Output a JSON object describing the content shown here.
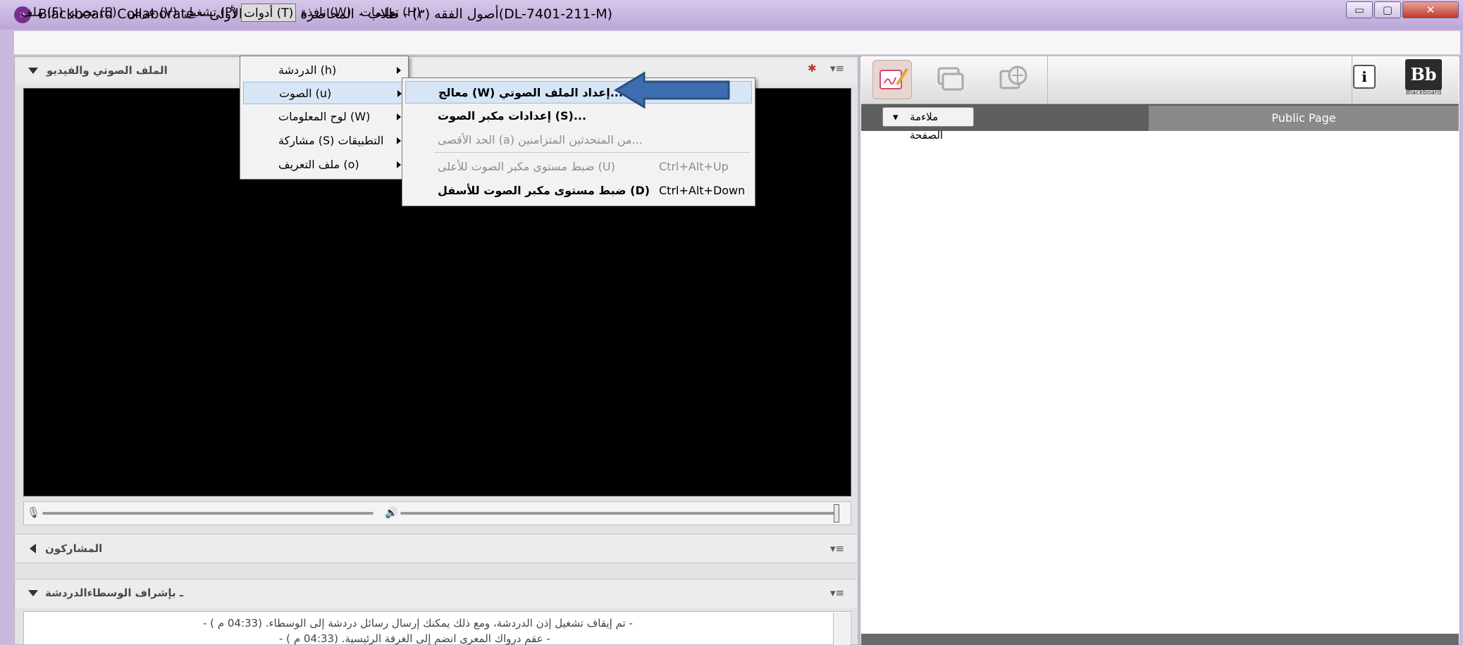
{
  "window": {
    "title": "Blackboard Collaborate – أصول الفقه (٣) - طلاب - المحاضرة المباشرة الأولى(DL-7401-211-M)",
    "min_glyph": "▭",
    "max_glyph": "▢",
    "close_glyph": "✕"
  },
  "menubar": {
    "items": [
      {
        "label": "ملف (F)"
      },
      {
        "label": "تحرير (E)"
      },
      {
        "label": "عرض (V)"
      },
      {
        "label": "تشغيل (P)"
      },
      {
        "label": "أدوات (T)",
        "active": true
      },
      {
        "label": "نافذة (W)"
      },
      {
        "label": "تعليمات (H)"
      }
    ]
  },
  "tools_menu": {
    "items": [
      {
        "label": "الدردشة (h)",
        "has_submenu": true
      },
      {
        "label": "الصوت (u)",
        "has_submenu": true,
        "highlighted": true
      },
      {
        "label": "لوح المعلومات (W)",
        "has_submenu": true
      },
      {
        "label": "مشاركة (S) التطبيقات",
        "has_submenu": true
      },
      {
        "label": "ملف التعريف (o)",
        "has_submenu": true
      }
    ]
  },
  "audio_menu": {
    "items": [
      {
        "label": "معالج (W) إعداد الملف الصوتي...",
        "shortcut": "",
        "enabled": true,
        "highlighted": true
      },
      {
        "label": "إعدادات مكبر الصوت (S)...",
        "shortcut": "",
        "enabled": true
      },
      {
        "label": "الحد الأقصى (a) من المتحدثين المتزامنين...",
        "shortcut": "",
        "enabled": false
      },
      {
        "label": "ضبط مستوى مكبر الصوت للأعلى (U)",
        "shortcut": "Ctrl+Alt+Up",
        "enabled": false
      },
      {
        "label": "ضبط مستوى مكبر الصوت للأسفل (D)",
        "shortcut": "Ctrl+Alt+Down",
        "enabled": true
      }
    ]
  },
  "left_panel": {
    "audio_video_title": "الملف الصوتي والفيديو",
    "participants_title": "المشاركون",
    "chat_title": "ـ بإشراف الوسطاءالدردشة",
    "chat_lines": [
      "- (  تم إيقاف تشغيل إذن الدردشة، ومع ذلك يمكنك إرسال رسائل دردشة إلى الوسطاء. (04:33 م -",
      "- (  عقم درواك المعرى انضم إلى الغرفة الرئيسية. (04:33 م -"
    ]
  },
  "right_panel": {
    "tools": [
      "whiteboard-icon",
      "app-share-icon",
      "web-tour-icon"
    ],
    "fit_label": "ملاءمة الصفحة",
    "page_tab": "Public Page",
    "info_glyph": "i",
    "brand_logo": "Bb",
    "brand_name": "Blackboard"
  },
  "colors": {
    "window_frame": "#c9b9dd",
    "menu_highlight": "#d6e6f7",
    "arrow": "#3d6fb0",
    "video_bg": "#000000"
  }
}
